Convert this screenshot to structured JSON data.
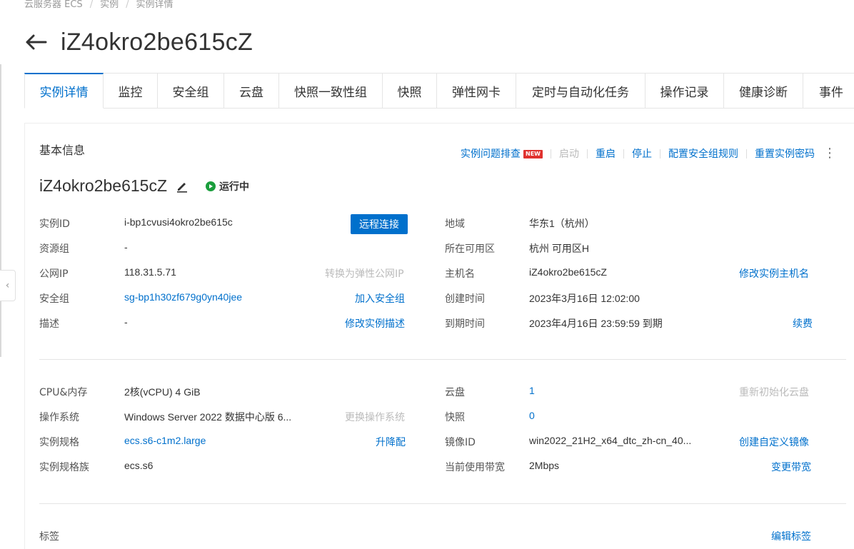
{
  "breadcrumb": [
    "云服务器 ECS",
    "实例",
    "实例详情"
  ],
  "page_title": "iZ4okro2be615cZ",
  "tabs": [
    "实例详情",
    "监控",
    "安全组",
    "云盘",
    "快照一致性组",
    "快照",
    "弹性网卡",
    "定时与自动化任务",
    "操作记录",
    "健康诊断",
    "事件"
  ],
  "basic_info": {
    "title": "基本信息",
    "actions": {
      "troubleshoot": "实例问题排查",
      "new_badge": "NEW",
      "start": "启动",
      "restart": "重启",
      "stop": "停止",
      "config_sg_rules": "配置安全组规则",
      "reset_password": "重置实例密码"
    },
    "instance_name": "iZ4okro2be615cZ",
    "status": "运行中",
    "remote_connect": "远程连接",
    "left": {
      "instance_id_label": "实例ID",
      "instance_id": "i-bp1cvusi4okro2be615c",
      "resource_group_label": "资源组",
      "resource_group": "-",
      "public_ip_label": "公网IP",
      "public_ip": "118.31.5.71",
      "convert_eip": "转换为弹性公网IP",
      "security_group_label": "安全组",
      "security_group": "sg-bp1h30zf679g0yn40jee",
      "join_sg": "加入安全组",
      "description_label": "描述",
      "description": "-",
      "edit_description": "修改实例描述"
    },
    "right": {
      "region_label": "地域",
      "region": "华东1（杭州）",
      "zone_label": "所在可用区",
      "zone": "杭州 可用区H",
      "hostname_label": "主机名",
      "hostname": "iZ4okro2be615cZ",
      "edit_hostname": "修改实例主机名",
      "created_label": "创建时间",
      "created": "2023年3月16日 12:02:00",
      "expire_label": "到期时间",
      "expire": "2023年4月16日 23:59:59 到期",
      "renew": "续费"
    }
  },
  "config": {
    "left": {
      "cpu_mem_label": "CPU&内存",
      "cpu_mem": "2核(vCPU) 4 GiB",
      "os_label": "操作系统",
      "os": "Windows Server 2022 数据中心版 6...",
      "change_os": "更换操作系统",
      "spec_label": "实例规格",
      "spec": "ecs.s6-c1m2.large",
      "upgrade": "升降配",
      "family_label": "实例规格族",
      "family": "ecs.s6"
    },
    "right": {
      "disk_label": "云盘",
      "disk": "1",
      "reinit_disk": "重新初始化云盘",
      "snapshot_label": "快照",
      "snapshot": "0",
      "image_label": "镜像ID",
      "image": "win2022_21H2_x64_dtc_zh-cn_40...",
      "create_image": "创建自定义镜像",
      "bandwidth_label": "当前使用带宽",
      "bandwidth": "2Mbps",
      "change_bandwidth": "变更带宽"
    }
  },
  "tags": {
    "label": "标签",
    "edit": "编辑标签"
  }
}
